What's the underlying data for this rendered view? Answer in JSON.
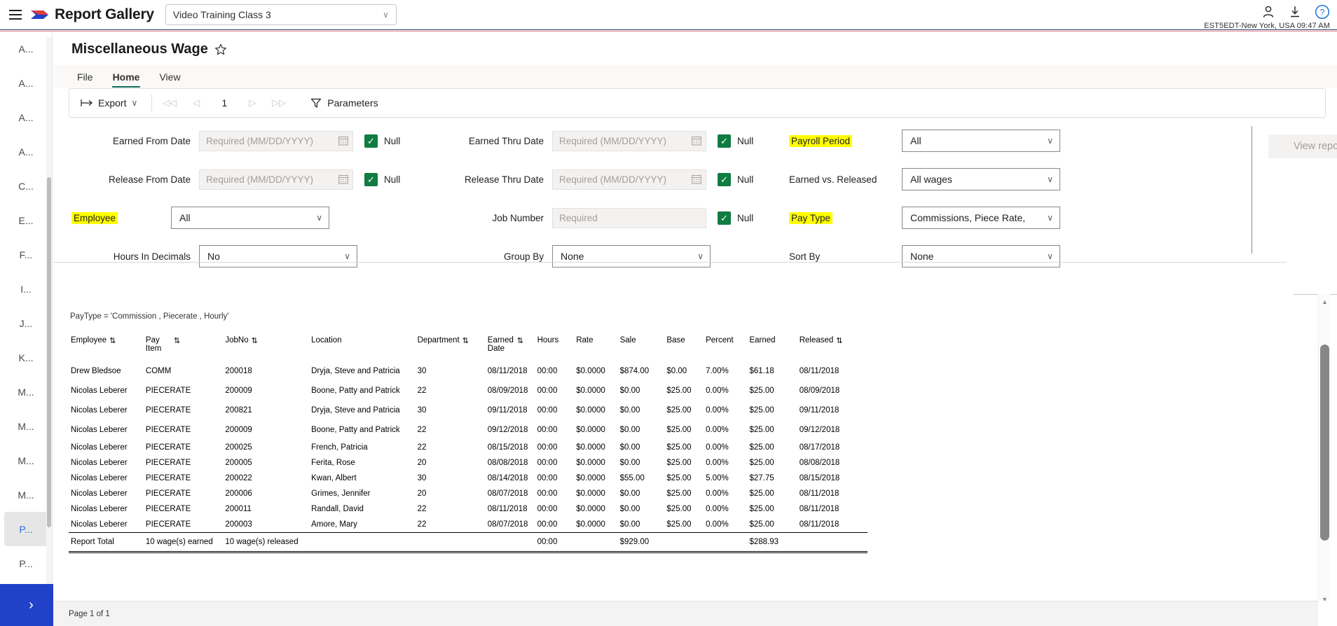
{
  "topbar": {
    "brand": "Report Gallery",
    "class_selector": {
      "value": "Video Training Class 3",
      "chevron": "∨"
    },
    "timezone": "EST5EDT-New York, USA 09:47 AM",
    "icons": {
      "user": "user-icon",
      "download": "download-icon",
      "help": "?"
    }
  },
  "leftnav": {
    "items": [
      {
        "label": "A...",
        "selected": false
      },
      {
        "label": "A...",
        "selected": false
      },
      {
        "label": "A...",
        "selected": false
      },
      {
        "label": "A...",
        "selected": false
      },
      {
        "label": "C...",
        "selected": false
      },
      {
        "label": "E...",
        "selected": false
      },
      {
        "label": "F...",
        "selected": false
      },
      {
        "label": "I...",
        "selected": false
      },
      {
        "label": "J...",
        "selected": false
      },
      {
        "label": "K...",
        "selected": false
      },
      {
        "label": "M...",
        "selected": false
      },
      {
        "label": "M...",
        "selected": false
      },
      {
        "label": "M...",
        "selected": false
      },
      {
        "label": "M...",
        "selected": false
      },
      {
        "label": "P...",
        "selected": true
      },
      {
        "label": "P...",
        "selected": false
      }
    ],
    "expand_label": "›"
  },
  "report": {
    "title": "Miscellaneous Wage",
    "tabs": [
      {
        "label": "File",
        "active": false
      },
      {
        "label": "Home",
        "active": true
      },
      {
        "label": "View",
        "active": false
      }
    ],
    "toolbar": {
      "export_label": "Export",
      "export_chevron": "∨",
      "page_number": "1",
      "first_label": "◁◁",
      "prev_label": "◁",
      "next_label": "▷",
      "last_label": "▷▷",
      "parameters_label": "Parameters"
    },
    "view_report_label": "View report"
  },
  "parameters": {
    "earned_from_date": {
      "label": "Earned From Date",
      "placeholder": "Required (MM/DD/YYYY)",
      "null_label": "Null",
      "null_checked": true,
      "highlighted": false
    },
    "release_from_date": {
      "label": "Release From Date",
      "placeholder": "Required (MM/DD/YYYY)",
      "null_label": "Null",
      "null_checked": true,
      "highlighted": false
    },
    "employee": {
      "label": "Employee",
      "value": "All",
      "highlighted": true
    },
    "hours_in_decimals": {
      "label": "Hours In Decimals",
      "value": "No",
      "highlighted": false
    },
    "earned_thru_date": {
      "label": "Earned Thru Date",
      "placeholder": "Required (MM/DD/YYYY)",
      "null_label": "Null",
      "null_checked": true,
      "highlighted": false
    },
    "release_thru_date": {
      "label": "Release Thru Date",
      "placeholder": "Required (MM/DD/YYYY)",
      "null_label": "Null",
      "null_checked": true,
      "highlighted": false
    },
    "job_number": {
      "label": "Job Number",
      "placeholder": "Required",
      "null_label": "Null",
      "null_checked": true,
      "highlighted": false
    },
    "group_by": {
      "label": "Group By",
      "value": "None",
      "highlighted": false
    },
    "payroll_period": {
      "label": "Payroll Period",
      "value": "All",
      "highlighted": true
    },
    "earned_vs_released": {
      "label": "Earned vs. Released",
      "value": "All wages",
      "highlighted": false
    },
    "pay_type": {
      "label": "Pay Type",
      "value": "Commissions, Piece Rate,",
      "highlighted": true
    },
    "sort_by": {
      "label": "Sort By",
      "value": "None",
      "highlighted": false
    },
    "chevron": "∨",
    "check_glyph": "✓"
  },
  "output": {
    "filter_note": "PayType = 'Commission , Piecerate , Hourly'",
    "sort_glyph": "⇅",
    "columns": [
      {
        "label": "Employee",
        "sortable": true
      },
      {
        "label": "Pay Item",
        "sortable": true
      },
      {
        "label": "JobNo",
        "sortable": true
      },
      {
        "label": "Location",
        "sortable": false
      },
      {
        "label": "Department",
        "sortable": true
      },
      {
        "label": "Earned Date",
        "sortable": true
      },
      {
        "label": "Hours",
        "sortable": false
      },
      {
        "label": "Rate",
        "sortable": false
      },
      {
        "label": "Sale",
        "sortable": false
      },
      {
        "label": "Base",
        "sortable": false
      },
      {
        "label": "Percent",
        "sortable": false
      },
      {
        "label": "Earned",
        "sortable": false
      },
      {
        "label": "Released",
        "sortable": true
      }
    ],
    "rows": [
      [
        "Drew Bledsoe",
        "COMM",
        "200018",
        "Dryja, Steve and Patricia",
        "30",
        "08/11/2018",
        "00:00",
        "$0.0000",
        "$874.00",
        "$0.00",
        "7.00%",
        "$61.18",
        "08/11/2018"
      ],
      [
        "Nicolas Leberer",
        "PIECERATE",
        "200009",
        "Boone, Patty and Patrick",
        "22",
        "08/09/2018",
        "00:00",
        "$0.0000",
        "$0.00",
        "$25.00",
        "0.00%",
        "$25.00",
        "08/09/2018"
      ],
      [
        "Nicolas Leberer",
        "PIECERATE",
        "200821",
        "Dryja, Steve and Patricia",
        "30",
        "09/11/2018",
        "00:00",
        "$0.0000",
        "$0.00",
        "$25.00",
        "0.00%",
        "$25.00",
        "09/11/2018"
      ],
      [
        "Nicolas Leberer",
        "PIECERATE",
        "200009",
        "Boone, Patty and Patrick",
        "22",
        "09/12/2018",
        "00:00",
        "$0.0000",
        "$0.00",
        "$25.00",
        "0.00%",
        "$25.00",
        "09/12/2018"
      ],
      [
        "Nicolas Leberer",
        "PIECERATE",
        "200025",
        "French, Patricia",
        "22",
        "08/15/2018",
        "00:00",
        "$0.0000",
        "$0.00",
        "$25.00",
        "0.00%",
        "$25.00",
        "08/17/2018"
      ],
      [
        "Nicolas Leberer",
        "PIECERATE",
        "200005",
        "Ferita, Rose",
        "20",
        "08/08/2018",
        "00:00",
        "$0.0000",
        "$0.00",
        "$25.00",
        "0.00%",
        "$25.00",
        "08/08/2018"
      ],
      [
        "Nicolas Leberer",
        "PIECERATE",
        "200022",
        "Kwan, Albert",
        "30",
        "08/14/2018",
        "00:00",
        "$0.0000",
        "$55.00",
        "$25.00",
        "5.00%",
        "$27.75",
        "08/15/2018"
      ],
      [
        "Nicolas Leberer",
        "PIECERATE",
        "200006",
        "Grimes, Jennifer",
        "20",
        "08/07/2018",
        "00:00",
        "$0.0000",
        "$0.00",
        "$25.00",
        "0.00%",
        "$25.00",
        "08/11/2018"
      ],
      [
        "Nicolas Leberer",
        "PIECERATE",
        "200011",
        "Randall, David",
        "22",
        "08/11/2018",
        "00:00",
        "$0.0000",
        "$0.00",
        "$25.00",
        "0.00%",
        "$25.00",
        "08/11/2018"
      ],
      [
        "Nicolas Leberer",
        "PIECERATE",
        "200003",
        "Amore, Mary",
        "22",
        "08/07/2018",
        "00:00",
        "$0.0000",
        "$0.00",
        "$25.00",
        "0.00%",
        "$25.00",
        "08/11/2018"
      ]
    ],
    "total_row": [
      "Report Total",
      "10 wage(s) earned",
      "10 wage(s) released",
      "",
      "",
      "",
      "00:00",
      "",
      "$929.00",
      "",
      "",
      "$288.93",
      ""
    ],
    "page_status": "Page 1 of 1"
  }
}
